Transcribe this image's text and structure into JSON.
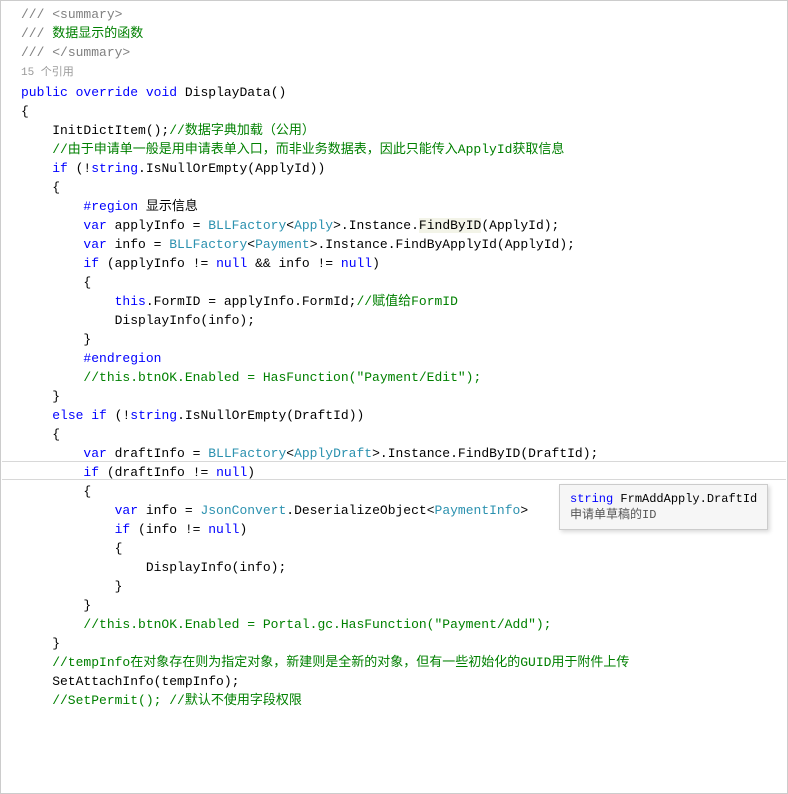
{
  "code": {
    "l1_a": "/// ",
    "l1_b": "<summary>",
    "l2_a": "/// ",
    "l2_b": "数据显示的函数",
    "l3_a": "/// ",
    "l3_b": "</summary>",
    "l4": "15 个引用",
    "l5_kw1": "public",
    "l5_kw2": "override",
    "l5_kw3": "void",
    "l5_name": " DisplayData()",
    "l6": "{",
    "l7_a": "    InitDictItem();",
    "l7_b": "//数据字典加载（公用）",
    "l8": "",
    "l9": "    //由于申请单一般是用申请表单入口，而非业务数据表，因此只能传入ApplyId获取信息",
    "l10_kw": "if",
    "l10_a": " (!",
    "l10_kw2": "string",
    "l10_b": ".IsNullOrEmpty(ApplyId))",
    "l11": "    {",
    "l12_kw": "#region",
    "l12_txt": " 显示信息",
    "l13_kw": "var",
    "l13_a": " applyInfo = ",
    "l13_t1": "BLLFactory",
    "l13_b": "<",
    "l13_t2": "Apply",
    "l13_c": ">.Instance.",
    "l13_m": "FindByID",
    "l13_d": "(ApplyId);",
    "l14_kw": "var",
    "l14_a": " info = ",
    "l14_t1": "BLLFactory",
    "l14_b": "<",
    "l14_t2": "Payment",
    "l14_c": ">.Instance.FindByApplyId(ApplyId);",
    "l15_kw": "if",
    "l15_a": " (applyInfo != ",
    "l15_kw2": "null",
    "l15_b": " && info != ",
    "l15_kw3": "null",
    "l15_c": ")",
    "l16": "        {",
    "l17_kw": "this",
    "l17_a": ".FormID = applyInfo.FormId;",
    "l17_cmt": "//赋值给FormID",
    "l18": "            DisplayInfo(info);",
    "l19": "        }",
    "l20_kw": "#endregion",
    "l21": "        //this.btnOK.Enabled = HasFunction(\"Payment/Edit\");",
    "l22": "    }",
    "l23_kw1": "else",
    "l23_kw2": "if",
    "l23_a": " (!",
    "l23_kw3": "string",
    "l23_b": ".IsNullOrEmpty(DraftId))",
    "l24": "    {",
    "l25_kw": "var",
    "l25_a": " draftInfo = ",
    "l25_t1": "BLLFactory",
    "l25_b": "<",
    "l25_t2": "ApplyDraft",
    "l25_c": ">.Instance.Fin",
    "l25_m": "dByID",
    "l25_d": "(DraftId);",
    "l26_kw": "if",
    "l26_a": " (draftInfo != ",
    "l26_kw2": "null",
    "l26_b": ")",
    "l27": "        {",
    "l28_kw": "var",
    "l28_a": " info = ",
    "l28_t1": "JsonConvert",
    "l28_b": ".DeserializeObject<",
    "l28_t2": "PaymentInfo",
    "l28_c": ">",
    "l29_kw": "if",
    "l29_a": " (info != ",
    "l29_kw2": "null",
    "l29_b": ")",
    "l30": "            {",
    "l31": "                DisplayInfo(info);",
    "l32": "            }",
    "l33": "        }",
    "l34": "",
    "l35": "        //this.btnOK.Enabled = Portal.gc.HasFunction(\"Payment/Add\");",
    "l36": "    }",
    "l37": "",
    "l38": "    //tempInfo在对象存在则为指定对象，新建则是全新的对象，但有一些初始化的GUID用于附件上传",
    "l39": "    SetAttachInfo(tempInfo);",
    "l40": "",
    "l41": "    //SetPermit(); //默认不使用字段权限"
  },
  "tooltip": {
    "kw": "string",
    "sig": " FrmAddApply.DraftId",
    "desc": "申请单草稿的ID"
  }
}
